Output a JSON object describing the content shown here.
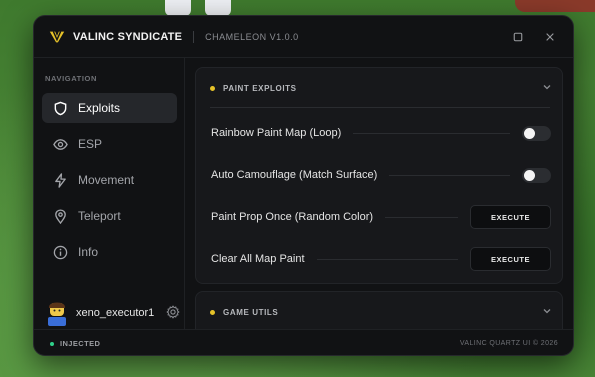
{
  "window": {
    "brand": "VALINC SYNDICATE",
    "version": "CHAMELEON V1.0.0"
  },
  "sidebar": {
    "heading": "NAVIGATION",
    "items": [
      {
        "label": "Exploits",
        "icon": "shield-icon",
        "active": true
      },
      {
        "label": "ESP",
        "icon": "eye-icon",
        "active": false
      },
      {
        "label": "Movement",
        "icon": "lightning-icon",
        "active": false
      },
      {
        "label": "Teleport",
        "icon": "map-pin-icon",
        "active": false
      },
      {
        "label": "Info",
        "icon": "info-icon",
        "active": false
      }
    ],
    "user": {
      "name": "xeno_executor1"
    }
  },
  "panels": {
    "paint": {
      "title": "PAINT EXPLOITS",
      "rows": [
        {
          "label": "Rainbow Paint Map (Loop)",
          "control": "toggle",
          "on": false
        },
        {
          "label": "Auto Camouflage (Match Surface)",
          "control": "toggle",
          "on": false
        },
        {
          "label": "Paint Prop Once (Random Color)",
          "control": "button",
          "button": "EXECUTE"
        },
        {
          "label": "Clear All Map Paint",
          "control": "button",
          "button": "EXECUTE"
        }
      ]
    },
    "game": {
      "title": "GAME UTILS"
    }
  },
  "status": {
    "text": "INJECTED",
    "footer": "VALINC QUARTZ UI © 2026"
  },
  "colors": {
    "accent": "#e6c229",
    "status": "#2fd08a",
    "background": "#111214"
  }
}
